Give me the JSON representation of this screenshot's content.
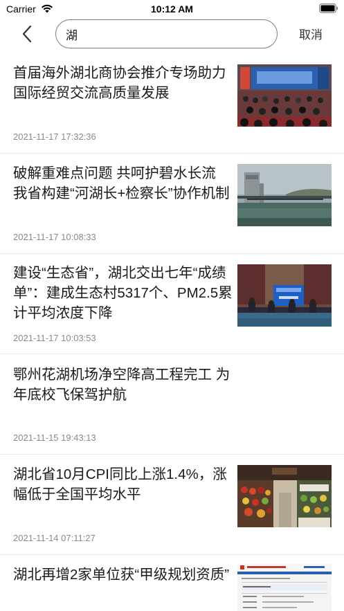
{
  "status_bar": {
    "carrier": "Carrier",
    "time": "10:12 AM",
    "icons": [
      "wifi-icon",
      "battery-icon"
    ]
  },
  "search": {
    "back_icon": "chevron-left-icon",
    "query": "湖",
    "cancel_label": "取消"
  },
  "news": [
    {
      "title": " 首届海外湖北商协会推介专场助力国际经贸交流高质量发展",
      "date": "2021-11-17 17:32:36",
      "thumbnail": "conference-hall-photo"
    },
    {
      "title": "破解重难点问题 共呵护碧水长流 我省构建“河湖长+检察长”协作机制",
      "date": "2021-11-17 10:08:33",
      "thumbnail": "river-dam-photo"
    },
    {
      "title": "建设“生态省”，湖北交出七年“成绩单”：建成生态村5317个、PM2.5累计平均浓度下降",
      "date": "2021-11-17 10:03:53",
      "thumbnail": "press-conference-photo"
    },
    {
      "title": "鄂州花湖机场净空降高工程完工 为年底校飞保驾护航",
      "date": "2021-11-15 19:43:13",
      "thumbnail": null
    },
    {
      "title": "湖北省10月CPI同比上涨1.4%，涨幅低于全国平均水平",
      "date": "2021-11-14 07:11:27",
      "thumbnail": "supermarket-produce-photo"
    },
    {
      "title": "湖北再增2家单位获“甲级规划资质”",
      "date": "",
      "thumbnail": "government-website-screenshot"
    }
  ]
}
